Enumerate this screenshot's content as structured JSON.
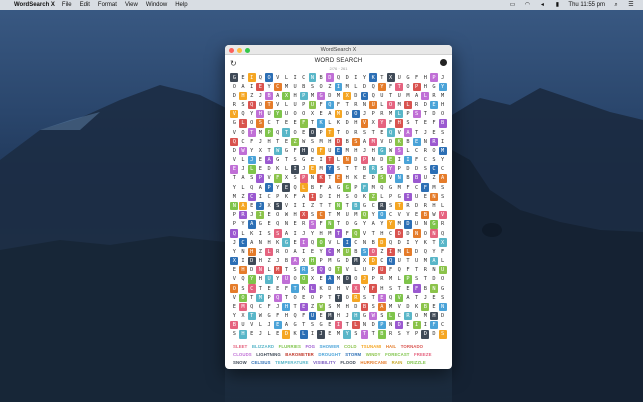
{
  "menubar": {
    "apple_icon": "apple-logo-icon",
    "app_name": "WordSearch X",
    "menus": [
      "File",
      "Edit",
      "Format",
      "View",
      "Window",
      "Help"
    ],
    "clock": "Thu 11:55 pm"
  },
  "window": {
    "title": "WordSearch X",
    "game_title": "WORD SEARCH",
    "game_subtitle": "2/76 · 261"
  },
  "grid": {
    "rows": [
      "GEIQOVLICNBDQDIYKTXUGFHPJCANHK",
      "ZLROAIEYCMUBSOZIMLDQYFTOPHGYNH",
      "LRMAXIDHZJBAXHPMGDMXDCQUTUMA",
      "DEHDNLMTSRSQOTVLUPUFQFTRNULOMLR",
      "JPRMLPSTDOAQVQYHUYUOOXEAMOO",
      "LKDHVXYFHSTEFBNGLOSCTEEFTK",
      "OPTTORSTEQVATJESROVOTMPQTOE",
      "ZWSMHDBSAMVDKBENRIXEMQCFJHTE",
      "YXTWGFHQFUEMHJHGWSLCROMHDW",
      "LJEAGTSGEITLNDPNDEIIFCSYKBUV",
      "SHEJLEDKLIJEMYSTTBRSYPDDSCCT",
      "BUZAXOTASPVFXSPNKTEHKEDSVNB",
      "FCFMSCIZYLQAPYEQLBFAGGPFMQGM",
      "SOKZLPGIUENSHMZCICPKFAIDIH",
      "BGCRSTRDRHLPLANAEJXSVIIZTTNT",
      "UMQYOCVVEBWVIRDHPRJIEOWHXSCTM",
      "RSFNTOGYAYYMDUNGRIOFPYAGEQNE",
      "SAIJYHMTFQVTHCDDNONQTRGQLKIS"
    ]
  },
  "word_list": [
    {
      "text": "SLEET",
      "color": "#e5637f"
    },
    {
      "text": "BLIZZARD",
      "color": "#59b6c8"
    },
    {
      "text": "FLURRIES",
      "color": "#7fc44b"
    },
    {
      "text": "FOG",
      "color": "#9b59d0"
    },
    {
      "text": "SHOWER",
      "color": "#4aa3d8"
    },
    {
      "text": "COLD",
      "color": "#8bc34a"
    },
    {
      "text": "TSUNAMI",
      "color": "#f5a623"
    },
    {
      "text": "HAIL",
      "color": "#e57c2a"
    },
    {
      "text": "TORNADO",
      "color": "#d9534f"
    },
    {
      "text": "CLOUDS",
      "color": "#c06fd6"
    },
    {
      "text": "LIGHTNING",
      "color": "#3f4a57"
    },
    {
      "text": "BAROMETER",
      "color": "#c0392b"
    },
    {
      "text": "DROUGHT",
      "color": "#4aa3d8"
    },
    {
      "text": "STORM",
      "color": "#2c6fb5"
    },
    {
      "text": "WINDY",
      "color": "#8bc34a"
    },
    {
      "text": "FORECAST",
      "color": "#7fc44b"
    },
    {
      "text": "FREEZE",
      "color": "#e5637f"
    },
    {
      "text": "SNOW",
      "color": "#3f4a57"
    },
    {
      "text": "CELSIUS",
      "color": "#2c6fb5"
    },
    {
      "text": "TEMPERATURE",
      "color": "#59b6c8"
    },
    {
      "text": "VISIBILITY",
      "color": "#7a5cc0"
    },
    {
      "text": "FLOOD",
      "color": "#3f4a57"
    },
    {
      "text": "HURRICANE",
      "color": "#e57c2a"
    },
    {
      "text": "RAIN",
      "color": "#c8a82a"
    },
    {
      "text": "DRIZZLE",
      "color": "#7fc44b"
    },
    {
      "text": "THUNDER",
      "color": "#d9534f"
    },
    {
      "text": "BAROMETER",
      "color": "#b7a6d6"
    },
    {
      "text": "OVERCAST",
      "color": "#d9534f"
    },
    {
      "text": "TYPHOON",
      "color": "#3f4a57"
    },
    {
      "text": "SUNNY",
      "color": "#e5637f"
    },
    {
      "text": "HUMID",
      "color": "#f5c242"
    },
    {
      "text": "HUMIDITY",
      "color": "#3f4a57"
    },
    {
      "text": "THERMOMETER",
      "color": "#4aa3d8"
    },
    {
      "text": "ICE",
      "color": "#59b6c8"
    },
    {
      "text": "CYCLONE",
      "color": "#3f4a57"
    },
    {
      "text": "MIST",
      "color": "#8fb0c8"
    },
    {
      "text": "MONSOON",
      "color": "#9b59d0"
    },
    {
      "text": "HOT",
      "color": "#3f4a57"
    },
    {
      "text": "FROST",
      "color": "#3f4a57"
    },
    {
      "text": "FAHRENHEIT",
      "color": "#7a5cc0"
    }
  ],
  "colors": {
    "window_bg": "#ffffff",
    "titlebar": "#e8e8e8"
  }
}
